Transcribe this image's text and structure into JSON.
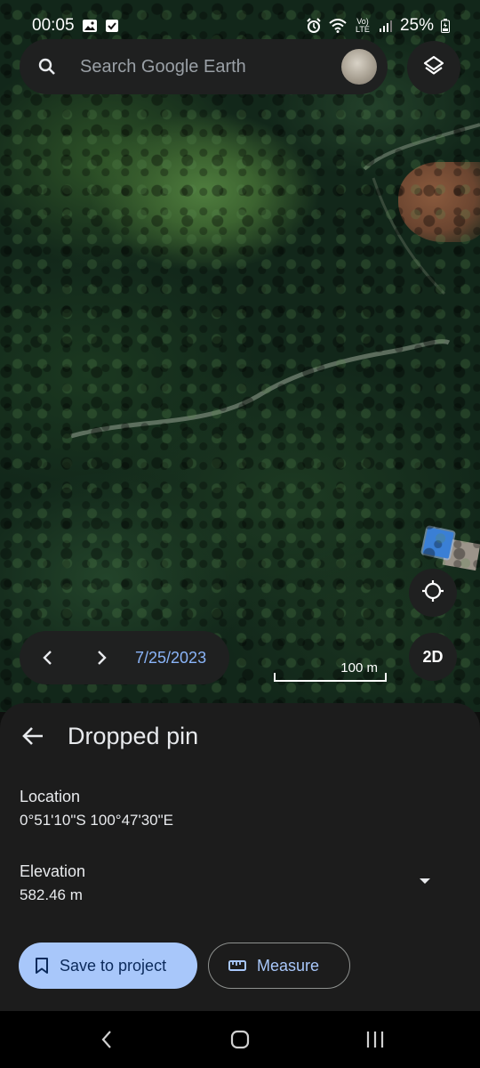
{
  "status_bar": {
    "time": "00:05",
    "battery": "25%",
    "network_label": "Vo) LTE"
  },
  "search": {
    "placeholder": "Search Google Earth"
  },
  "map": {
    "date": "7/25/2023",
    "scale_label": "100 m",
    "view_toggle": "2D"
  },
  "panel": {
    "title": "Dropped pin",
    "location_label": "Location",
    "location_value": "0°51'10\"S 100°47'30\"E",
    "elevation_label": "Elevation",
    "elevation_value": "582.46 m",
    "save_label": "Save to project",
    "measure_label": "Measure"
  },
  "colors": {
    "accent": "#a8c7fa",
    "date_text": "#8ab4f8",
    "sheet_bg": "#1c1c1c",
    "control_bg": "#1f2020"
  },
  "icons": [
    "search-icon",
    "layers-icon",
    "my-location-icon",
    "chevron-left-icon",
    "chevron-right-icon",
    "arrow-back-icon",
    "dropdown-icon",
    "bookmark-icon",
    "ruler-icon",
    "nav-back-icon",
    "nav-home-icon",
    "nav-recents-icon",
    "image-icon",
    "checkbox-icon",
    "alarm-icon",
    "wifi-icon",
    "signal-icon",
    "battery-icon"
  ]
}
